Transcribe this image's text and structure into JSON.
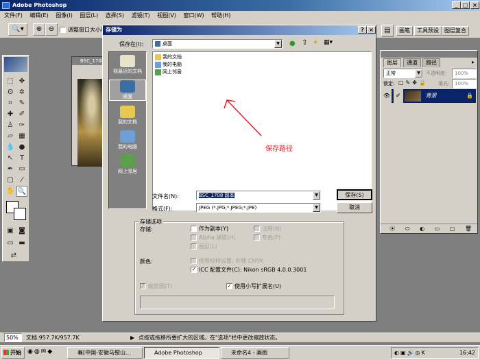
{
  "ps": {
    "title": "Adobe Photoshop",
    "menu": [
      "文件(F)",
      "编辑(E)",
      "图像(I)",
      "图层(L)",
      "选择(S)",
      "滤镜(T)",
      "视图(V)",
      "窗口(W)",
      "帮助(H)"
    ],
    "options_checkbox": "调整窗口大小以",
    "wells": [
      "画笔",
      "工具预设",
      "图层复合"
    ]
  },
  "image_window": {
    "title": "BSC_1708"
  },
  "layers_panel": {
    "tabs": [
      "图层",
      "通道",
      "路径"
    ],
    "blend_mode": "正常",
    "opacity_label": "不透明度:",
    "opacity_value": "100%",
    "lock_label": "锁定:",
    "fill_label": "填充:",
    "fill_value": "100%",
    "layer_name": "背景"
  },
  "dialog": {
    "title": "存储为",
    "save_in_label": "保存在(I):",
    "save_in_value": "桌面",
    "places": [
      "我最近的文档",
      "桌面",
      "我的文档",
      "我的电脑",
      "网上邻居"
    ],
    "files": [
      "我的文档",
      "我的电脑",
      "网上邻居"
    ],
    "annotation": "保存路径",
    "filename_label": "文件名(N):",
    "filename_value": "BSC_1708 副本",
    "format_label": "格式(F):",
    "format_value": "JPEG (*.JPG;*.JPEG;*.JPE)",
    "save_button": "保存(S)",
    "cancel_button": "取消",
    "options_group": "存储选项",
    "store_label": "存储:",
    "opt_as_copy": "作为副本(Y)",
    "opt_notes": "注释(N)",
    "opt_alpha": "Alpha 通道(H)",
    "opt_spot": "专色(P)",
    "opt_layers": "图层(L)",
    "color_label": "颜色:",
    "opt_proof": "使用校样设置: 处理 CMYK",
    "opt_icc": "ICC 配置文件(C): Nikon sRGB 4.0.0.3001",
    "opt_thumbnail": "缩览图(T)",
    "opt_lowercase": "使用小写扩展名(U)"
  },
  "statusbar": {
    "zoom": "50%",
    "doc_info": "文档:957.7K/957.7K",
    "hint": "点按或拖移所要扩大的区域。在\"选项\"栏中更改缩放状态。"
  },
  "taskbar": {
    "start": "开始",
    "tasks": [
      "春[中国-安徽马鞍山...",
      "Adobe Photoshop",
      "未命名4 - 画图"
    ],
    "clock": "16:42"
  }
}
